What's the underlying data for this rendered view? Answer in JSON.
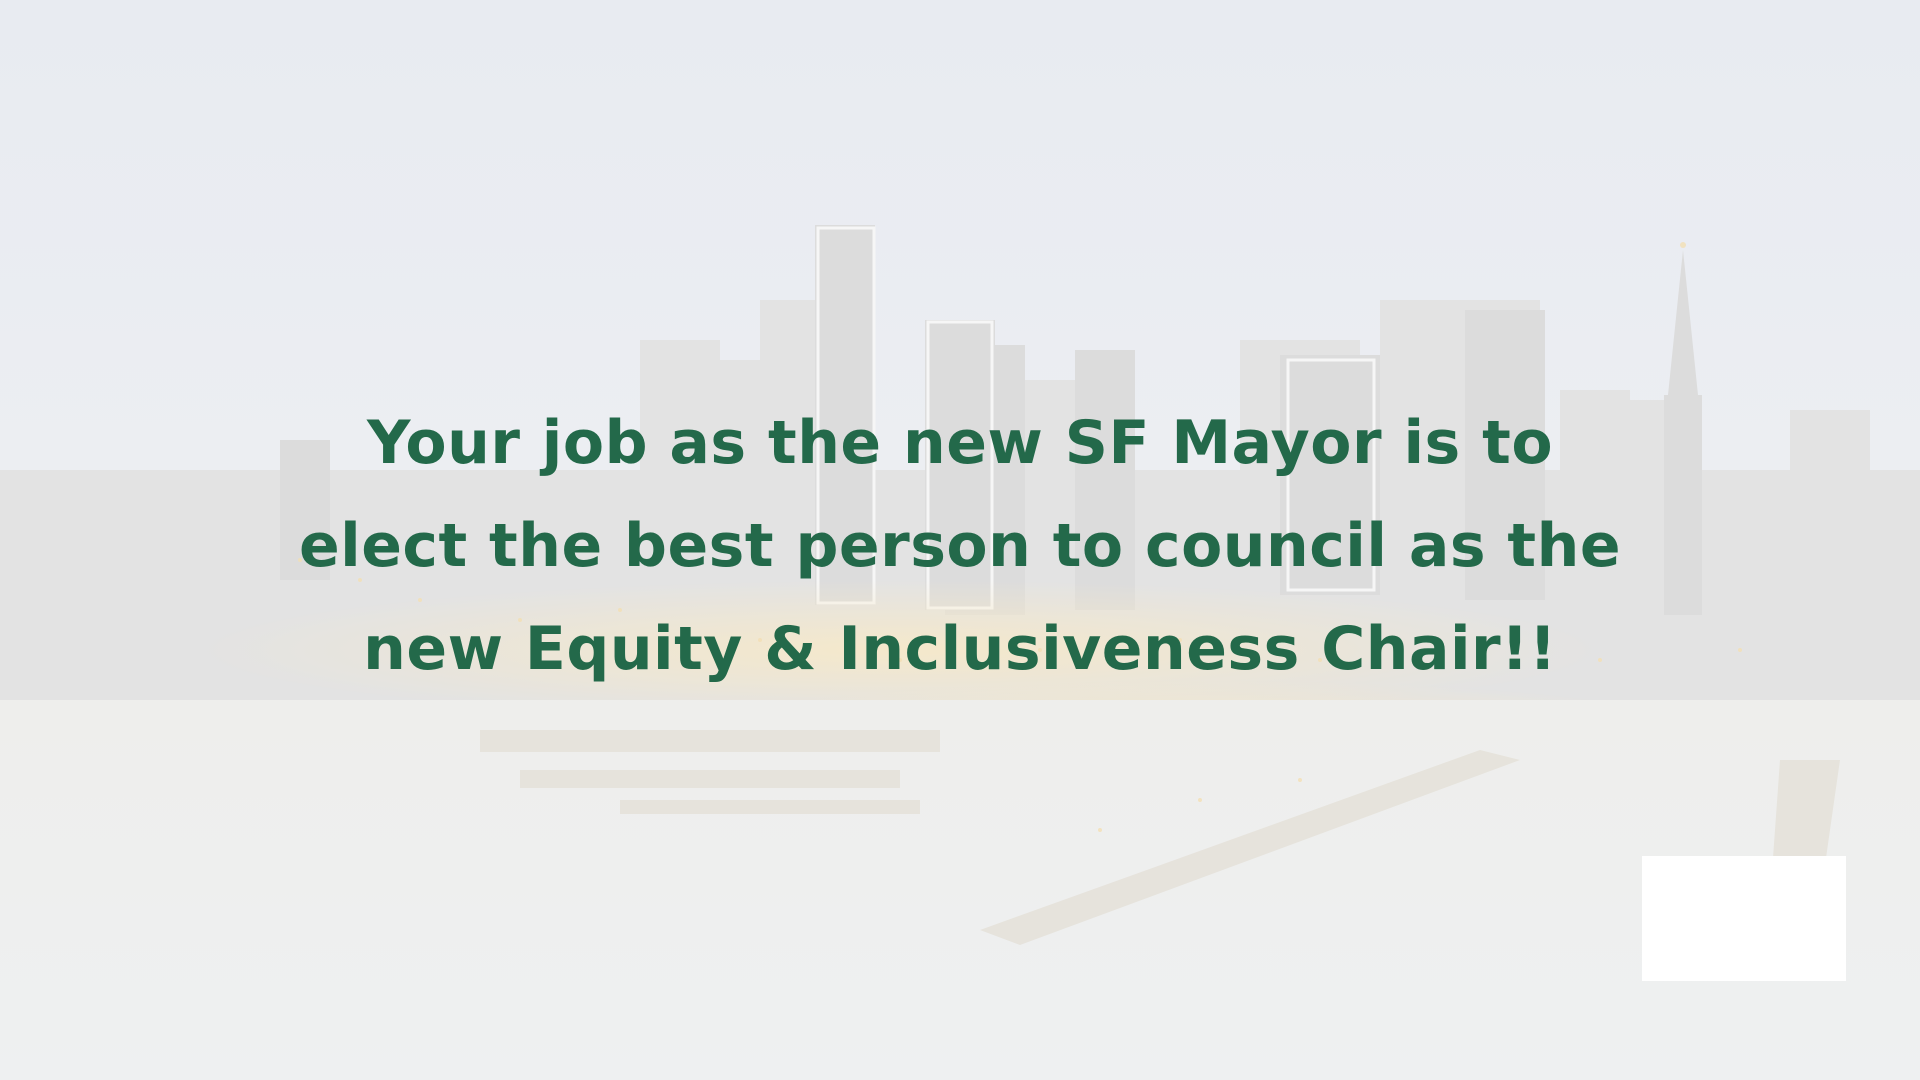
{
  "slide": {
    "headline_lines": [
      "Your job as the new SF Mayor is to",
      "elect the best person to council as the",
      "new Equity & Inclusiveness Chair!!"
    ],
    "text_color": "#23694a",
    "background_description_color": "#e9ecf0"
  },
  "icons": {
    "background": "city-skyline-image"
  }
}
